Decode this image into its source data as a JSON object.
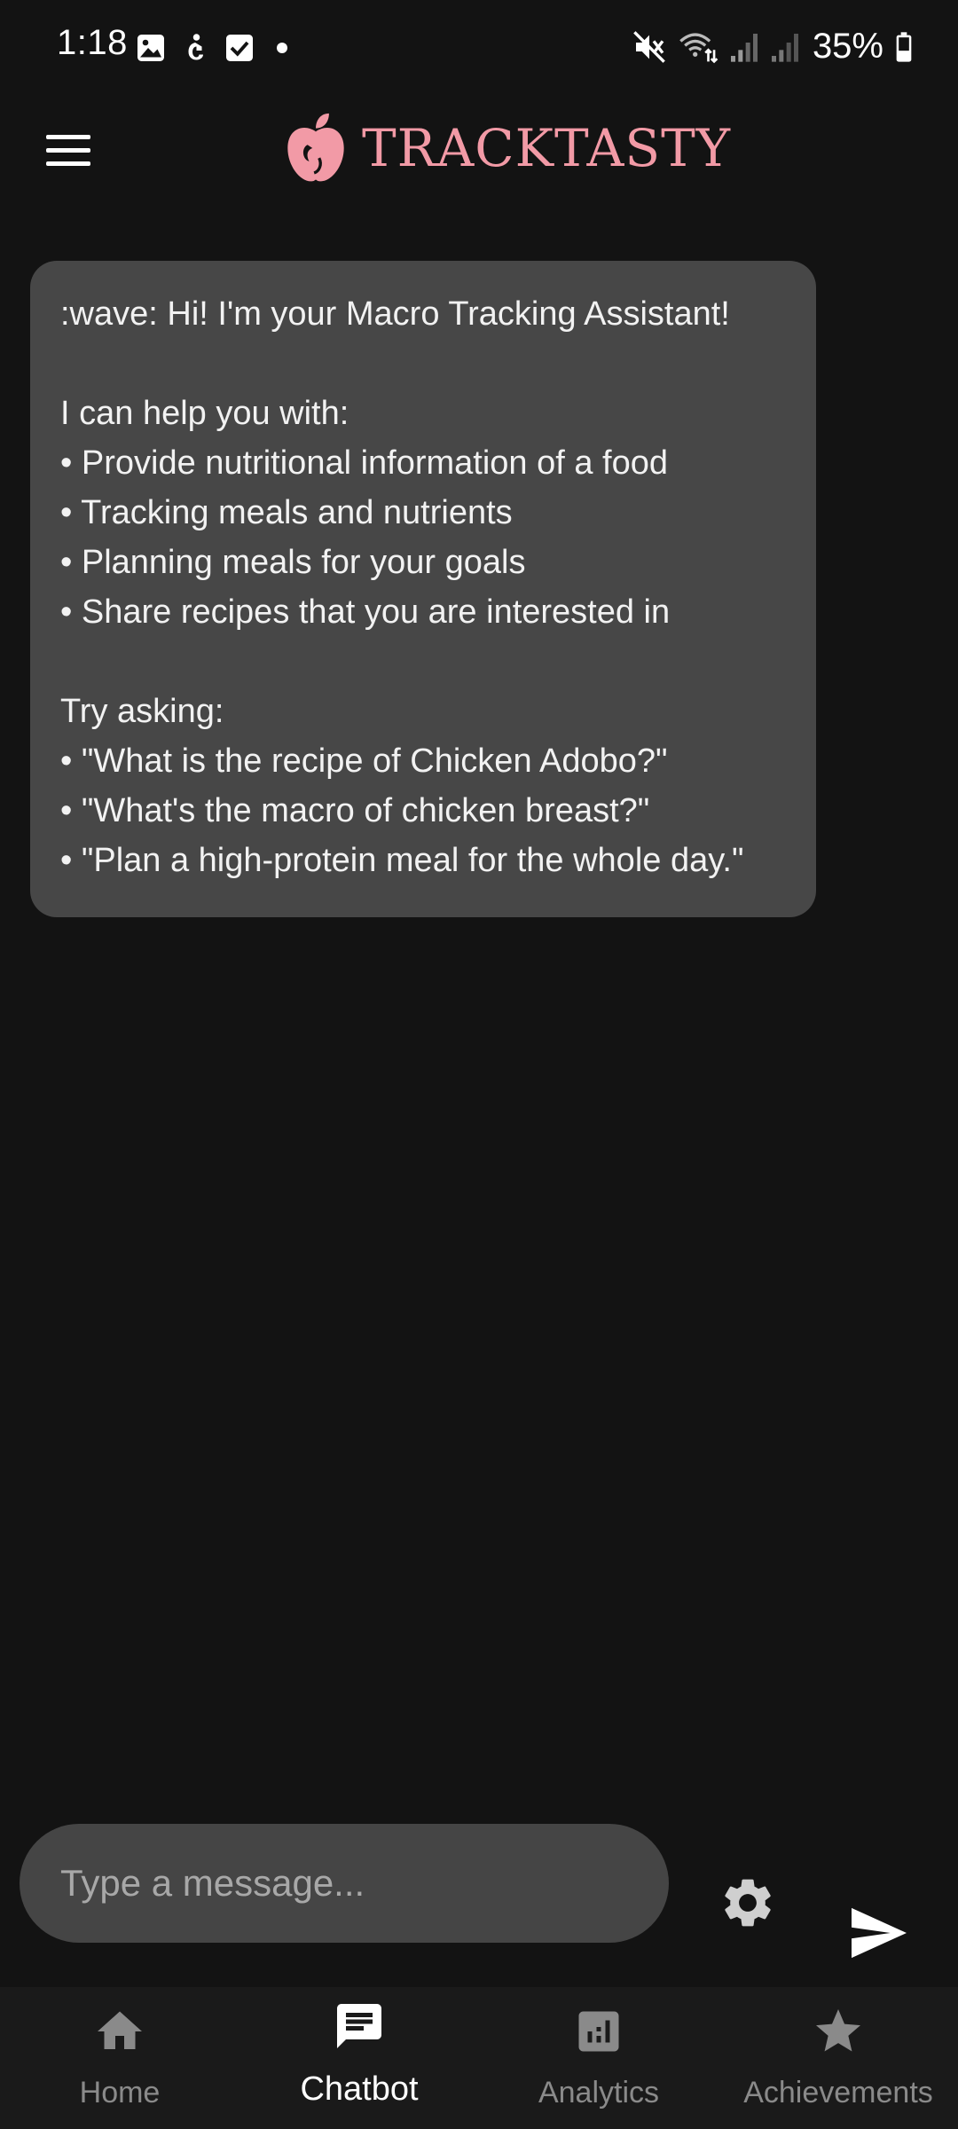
{
  "status_bar": {
    "time": "1:18",
    "battery": "35%",
    "left_icons": [
      "gallery-icon",
      "accessibility-icon",
      "checkbox-icon",
      "dot-icon"
    ],
    "right_icons": [
      "mute-icon",
      "wifi-icon",
      "signal-icon",
      "signal-icon",
      "battery-icon"
    ]
  },
  "header": {
    "menu_icon": "hamburger-menu-icon",
    "logo_text": "TRACKTASTY",
    "logo_icon": "apple-icon",
    "brand_color": "#f29aa6"
  },
  "chat": {
    "messages": [
      {
        "sender": "bot",
        "lines": [
          ":wave: Hi! I'm your Macro Tracking Assistant!",
          "",
          "I can help you with:",
          "• Provide nutritional information of a food",
          "• Tracking meals and nutrients",
          "• Planning meals for your goals",
          "• Share recipes that you are interested in",
          "",
          "Try asking:",
          "• \"What is the recipe of Chicken Adobo?\"",
          "• \"What's the macro of chicken breast?\"",
          "• \"Plan a high-protein meal for the whole day.\""
        ]
      }
    ]
  },
  "composer": {
    "placeholder": "Type a message...",
    "value": "",
    "settings_icon": "gear-icon",
    "send_icon": "send-icon"
  },
  "bottom_nav": {
    "active": "Chatbot",
    "items": [
      {
        "label": "Home",
        "icon": "home-icon"
      },
      {
        "label": "Chatbot",
        "icon": "chat-icon"
      },
      {
        "label": "Analytics",
        "icon": "analytics-icon"
      },
      {
        "label": "Achievements",
        "icon": "star-icon"
      }
    ]
  },
  "colors": {
    "background": "#131313",
    "bubble": "#474747",
    "input": "#454545",
    "nav_inactive": "#8a8a8a",
    "nav_active": "#ffffff"
  }
}
